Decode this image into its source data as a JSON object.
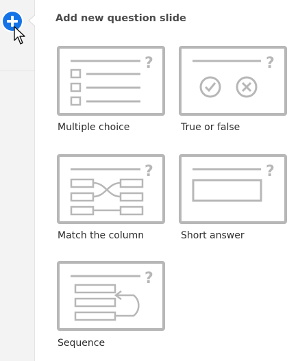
{
  "rail": {
    "add_button_icon": "plus-icon",
    "cursor_icon": "mouse-pointer-icon"
  },
  "panel": {
    "title": "Add new question slide"
  },
  "options": [
    {
      "label": "Multiple choice",
      "icon": "multiple-choice-icon"
    },
    {
      "label": "True or false",
      "icon": "true-false-icon"
    },
    {
      "label": "Match the column",
      "icon": "match-column-icon"
    },
    {
      "label": "Short answer",
      "icon": "short-answer-icon"
    },
    {
      "label": "Sequence",
      "icon": "sequence-icon"
    }
  ],
  "colors": {
    "accent": "#1473e6",
    "card_border": "#b7b7b7",
    "rail_bg": "#f3f3f3"
  }
}
